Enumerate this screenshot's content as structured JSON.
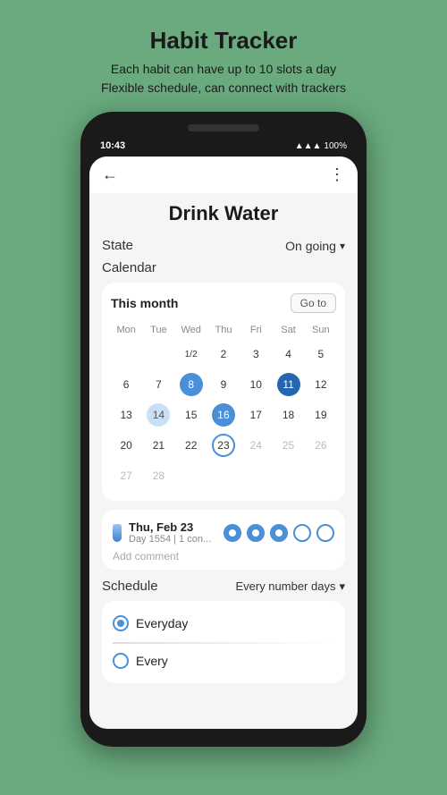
{
  "header": {
    "title": "Habit Tracker",
    "subtitle_line1": "Each habit can have up to 10 slots a day",
    "subtitle_line2": "Flexible schedule, can connect with trackers"
  },
  "statusBar": {
    "time": "10:43",
    "battery": "100%",
    "icons": "▲ ▲ ▲"
  },
  "appBar": {
    "back": "←",
    "more": "⋮"
  },
  "habitTitle": "Drink Water",
  "stateRow": {
    "label": "State",
    "value": "On going",
    "chevron": "▾"
  },
  "calendarSection": {
    "label": "Calendar",
    "monthLabel": "This month",
    "gotoBtn": "Go to",
    "dayHeaders": [
      "Mon",
      "Tue",
      "Wed",
      "Thu",
      "Fri",
      "Sat",
      "Sun"
    ],
    "weeks": [
      [
        {
          "num": "",
          "style": "empty"
        },
        {
          "num": "",
          "style": "empty"
        },
        {
          "num": "1/2",
          "style": "normal"
        },
        {
          "num": "2",
          "style": "normal"
        },
        {
          "num": "3",
          "style": "normal"
        },
        {
          "num": "4",
          "style": "normal"
        },
        {
          "num": "5",
          "style": "normal"
        }
      ],
      [
        {
          "num": "6",
          "style": "normal"
        },
        {
          "num": "7",
          "style": "normal"
        },
        {
          "num": "8",
          "style": "filled-blue"
        },
        {
          "num": "9",
          "style": "normal"
        },
        {
          "num": "10",
          "style": "normal"
        },
        {
          "num": "11",
          "style": "filled-dark-blue"
        },
        {
          "num": "12",
          "style": "normal"
        }
      ],
      [
        {
          "num": "13",
          "style": "normal"
        },
        {
          "num": "14",
          "style": "filled-light"
        },
        {
          "num": "15",
          "style": "normal"
        },
        {
          "num": "16",
          "style": "filled-blue"
        },
        {
          "num": "17",
          "style": "normal"
        },
        {
          "num": "18",
          "style": "normal"
        },
        {
          "num": "19",
          "style": "normal"
        }
      ],
      [
        {
          "num": "20",
          "style": "normal"
        },
        {
          "num": "21",
          "style": "normal"
        },
        {
          "num": "22",
          "style": "normal"
        },
        {
          "num": "23",
          "style": "today-outline"
        },
        {
          "num": "24",
          "style": "muted"
        },
        {
          "num": "25",
          "style": "muted"
        },
        {
          "num": "26",
          "style": "muted"
        }
      ],
      [
        {
          "num": "27",
          "style": "muted"
        },
        {
          "num": "28",
          "style": "muted"
        },
        {
          "num": "",
          "style": "empty"
        },
        {
          "num": "",
          "style": "empty"
        },
        {
          "num": "",
          "style": "empty"
        },
        {
          "num": "",
          "style": "empty"
        },
        {
          "num": "",
          "style": "empty"
        }
      ]
    ]
  },
  "detailCard": {
    "date": "Thu, Feb 23",
    "sub": "Day 1554 | 1 con...",
    "circles": [
      "filled",
      "filled",
      "filled",
      "empty",
      "empty"
    ],
    "addComment": "Add comment"
  },
  "scheduleSection": {
    "label": "Schedule",
    "value": "Every number days",
    "chevron": "▾",
    "options": [
      {
        "label": "Everyday",
        "selected": true
      },
      {
        "label": "Every",
        "selected": false
      }
    ]
  }
}
